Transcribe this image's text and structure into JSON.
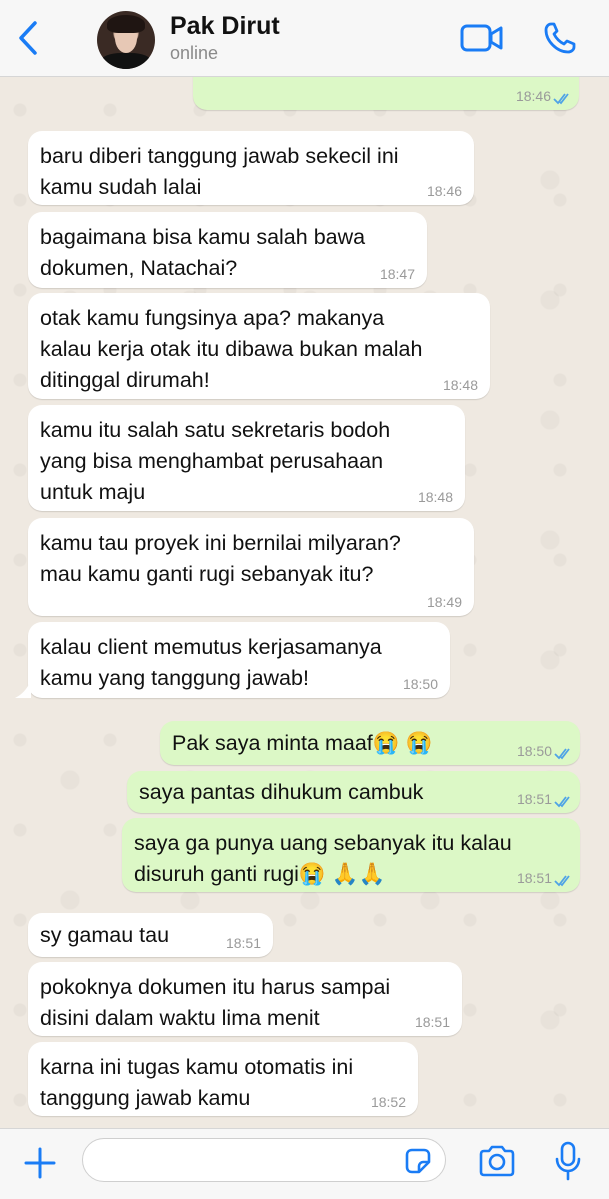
{
  "header": {
    "contact_name": "Pak Dirut",
    "status": "online",
    "back_icon": "chevron-left-icon",
    "video_icon": "video-camera-icon",
    "call_icon": "phone-icon",
    "accent_color": "#1a7cf5"
  },
  "messages": [
    {
      "direction": "out",
      "text": "",
      "time": "18:46",
      "read": true
    },
    {
      "direction": "in",
      "text": "baru diberi tanggung jawab sekecil ini\nkamu sudah lalai",
      "time": "18:46"
    },
    {
      "direction": "in",
      "text": "bagaimana bisa kamu salah bawa\ndokumen, Natachai?",
      "time": "18:47"
    },
    {
      "direction": "in",
      "text": "otak kamu fungsinya apa? makanya\nkalau kerja otak itu dibawa bukan malah\nditinggal dirumah!",
      "time": "18:48"
    },
    {
      "direction": "in",
      "text": "kamu itu salah satu sekretaris bodoh\nyang bisa menghambat perusahaan\nuntuk maju",
      "time": "18:48"
    },
    {
      "direction": "in",
      "text": "kamu tau proyek ini bernilai milyaran?\nmau kamu ganti rugi sebanyak itu?",
      "time": "18:49"
    },
    {
      "direction": "in",
      "text": "kalau client memutus kerjasamanya\nkamu yang tanggung jawab!",
      "time": "18:50"
    },
    {
      "direction": "out",
      "text": "Pak saya minta maaf😭 😭",
      "time": "18:50",
      "read": true
    },
    {
      "direction": "out",
      "text": "saya pantas dihukum cambuk",
      "time": "18:51",
      "read": true
    },
    {
      "direction": "out",
      "text": "saya ga punya uang sebanyak itu kalau\ndisuruh ganti rugi😭 🙏🙏",
      "time": "18:51",
      "read": true
    },
    {
      "direction": "in",
      "text": "sy gamau tau",
      "time": "18:51"
    },
    {
      "direction": "in",
      "text": "pokoknya dokumen itu harus sampai\ndisini dalam waktu lima menit",
      "time": "18:51"
    },
    {
      "direction": "in",
      "text": "karna ini tugas kamu otomatis ini\ntanggung jawab kamu",
      "time": "18:52"
    }
  ],
  "input_bar": {
    "placeholder": "",
    "plus_icon": "plus-icon",
    "sticker_icon": "sticker-icon",
    "camera_icon": "camera-icon",
    "mic_icon": "microphone-icon"
  },
  "colors": {
    "incoming_bubble": "#ffffff",
    "outgoing_bubble": "#dcf8c6",
    "read_ticks": "#4fa3e6"
  }
}
